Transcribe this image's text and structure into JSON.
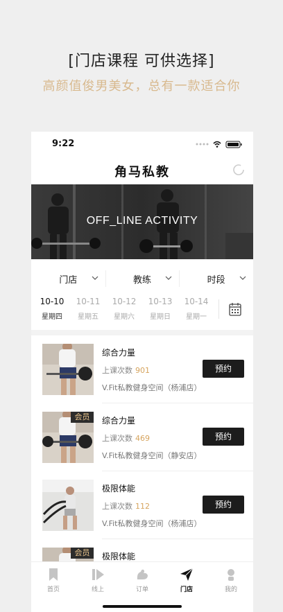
{
  "promo": {
    "title": "[门店课程 可供选择]",
    "subtitle": "高颜值俊男美女，总有一款适合你"
  },
  "status": {
    "time": "9:22"
  },
  "nav": {
    "title": "角马私教"
  },
  "banner": {
    "caption": "OFF_LINE ACTIVITY"
  },
  "filters": [
    {
      "label": "门店"
    },
    {
      "label": "教练"
    },
    {
      "label": "时段"
    }
  ],
  "dates": [
    {
      "date": "10-10",
      "weekday": "星期四",
      "active": true
    },
    {
      "date": "10-11",
      "weekday": "星期五",
      "active": false
    },
    {
      "date": "10-12",
      "weekday": "星期六",
      "active": false
    },
    {
      "date": "10-13",
      "weekday": "星期日",
      "active": false
    },
    {
      "date": "10-14",
      "weekday": "星期一",
      "active": false
    }
  ],
  "courses": [
    {
      "name": "综合力量",
      "count_label": "上课次数",
      "count": "901",
      "store": "V.Fit私教健身空间（杨浦店）",
      "book": "预约",
      "badge": ""
    },
    {
      "name": "综合力量",
      "count_label": "上课次数",
      "count": "469",
      "store": "V.Fit私教健身空间（静安店）",
      "book": "预约",
      "badge": "会员"
    },
    {
      "name": "极限体能",
      "count_label": "上课次数",
      "count": "112",
      "store": "V.Fit私教健身空间（杨浦店）",
      "book": "预约",
      "badge": ""
    },
    {
      "name": "极限体能",
      "count_label": "",
      "count": "",
      "store": "",
      "book": "",
      "badge": "会员"
    }
  ],
  "tabs": [
    {
      "label": "首页",
      "icon": "bookmark-icon",
      "active": false
    },
    {
      "label": "线上",
      "icon": "play-icon",
      "active": false
    },
    {
      "label": "订单",
      "icon": "muscle-icon",
      "active": false
    },
    {
      "label": "门店",
      "icon": "paper-plane-icon",
      "active": true
    },
    {
      "label": "我的",
      "icon": "user-icon",
      "active": false
    }
  ],
  "colors": {
    "accent": "#d8b98e",
    "count": "#d6a45e",
    "button": "#1c1c1c",
    "badge_text": "#e8c28a"
  }
}
